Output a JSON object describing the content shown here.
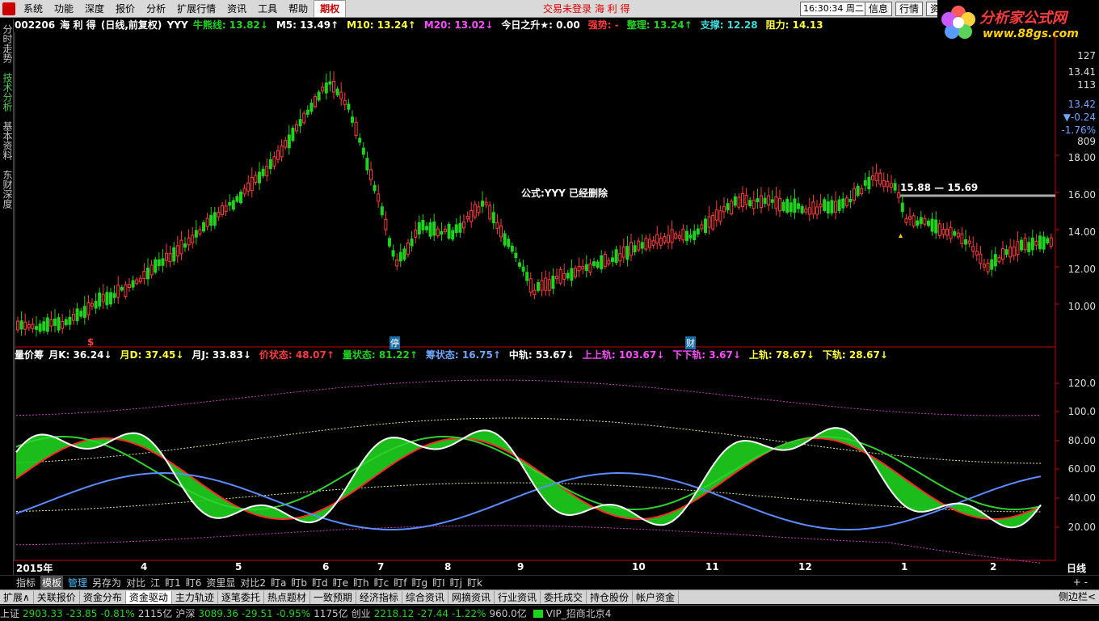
{
  "menu": {
    "items": [
      "系统",
      "功能",
      "深度",
      "报价",
      "分析",
      "扩展行情",
      "资讯",
      "工具",
      "帮助"
    ],
    "active_item": "期权",
    "trade_status": "交易未登录   海 利 得",
    "clock": "16:30:34 周二",
    "buttons": [
      "信息",
      "行情",
      "资"
    ]
  },
  "logo": {
    "brand": "分析家公式网",
    "url": "www.88gs.com"
  },
  "left_tabs": [
    "分时走势",
    "技术分析",
    "基本资料",
    "东财深度"
  ],
  "left_tab_selected": 1,
  "price_header": {
    "code": "002206",
    "name": "海 利 得",
    "period": "(日线,前复权)",
    "formula": "YYY",
    "items": [
      {
        "label": "牛熊线",
        "value": "13.82",
        "arrow": "↓",
        "color": "#1ed31e"
      },
      {
        "label": "M5",
        "value": "13.49",
        "arrow": "↑",
        "color": "#ffffff"
      },
      {
        "label": "M10",
        "value": "13.24",
        "arrow": "↑",
        "color": "#ffff3b"
      },
      {
        "label": "M20",
        "value": "13.02",
        "arrow": "↓",
        "color": "#ff4cff"
      },
      {
        "label": "今日之升★",
        "value": "0.00",
        "arrow": "",
        "color": "#ffffff"
      },
      {
        "label": "强势",
        "value": "-",
        "arrow": "",
        "color": "#ff3b3b"
      },
      {
        "label": "整理",
        "value": "13.24",
        "arrow": "↑",
        "color": "#1ed31e"
      },
      {
        "label": "支撑",
        "value": "12.28",
        "arrow": "",
        "color": "#3fdcdc"
      },
      {
        "label": "阻力",
        "value": "14.13",
        "arrow": "",
        "color": "#ffff3b"
      }
    ]
  },
  "price_axis": {
    "labels": [
      "127",
      "13.41",
      "113",
      "13.42",
      "▼-0.24",
      "-1.76%",
      "809",
      "18.00",
      "16.00",
      "14.00",
      "12.00",
      "10.00"
    ],
    "colors": [
      "#dddddd",
      "#dddddd",
      "#dddddd",
      "#6da8ff",
      "#6da8ff",
      "#6da8ff",
      "#dddddd",
      "#dddddd",
      "#dddddd",
      "#dddddd",
      "#dddddd",
      "#dddddd"
    ]
  },
  "annotations": {
    "formula_deleted": "公式:YYY 已经删除",
    "range_label": "15.88 — 15.69",
    "marks": [
      "$",
      "停",
      "财"
    ]
  },
  "indicator_header": {
    "title": "量价筹",
    "items": [
      {
        "label": "月K",
        "value": "36.24",
        "arrow": "↓",
        "color": "#ffffff"
      },
      {
        "label": "月D",
        "value": "37.45",
        "arrow": "↓",
        "color": "#ffff3b"
      },
      {
        "label": "月J",
        "value": "33.83",
        "arrow": "↓",
        "color": "#ffffff"
      },
      {
        "label": "价状态",
        "value": "48.07",
        "arrow": "↑",
        "color": "#ff3b3b"
      },
      {
        "label": "量状态",
        "value": "81.22",
        "arrow": "↑",
        "color": "#1ed31e"
      },
      {
        "label": "筹状态",
        "value": "16.75",
        "arrow": "↑",
        "color": "#6da8ff"
      },
      {
        "label": "中轨",
        "value": "53.67",
        "arrow": "↓",
        "color": "#ffffff"
      },
      {
        "label": "上上轨",
        "value": "103.67",
        "arrow": "↓",
        "color": "#ff4cff"
      },
      {
        "label": "下下轨",
        "value": "3.67",
        "arrow": "↓",
        "color": "#ff4cff"
      },
      {
        "label": "上轨",
        "value": "78.67",
        "arrow": "↓",
        "color": "#ffff3b"
      },
      {
        "label": "下轨",
        "value": "28.67",
        "arrow": "↓",
        "color": "#ffff3b"
      }
    ]
  },
  "indicator_axis": [
    "120.0",
    "100.0",
    "80.00",
    "60.00",
    "40.00",
    "20.00"
  ],
  "x_axis": [
    "2015年",
    "4",
    "5",
    "6",
    "7",
    "8",
    "9",
    "10",
    "11",
    "12",
    "1",
    "2",
    "日线"
  ],
  "indicator_tabs": [
    "指标",
    "模板",
    "管理",
    "另存为",
    "对比",
    "江",
    "盯1",
    "盯6",
    "资里显",
    "对比2",
    "盯a",
    "盯b",
    "盯d",
    "盯e",
    "盯h",
    "盯c",
    "盯f",
    "盯g",
    "盯I",
    "盯j",
    "盯k"
  ],
  "indicator_tab_selected": 1,
  "indicator_tab_highlight": 2,
  "zoom_buttons": "+ -",
  "func_tabs": [
    "扩展∧",
    "关联报价",
    "资金分布",
    "资金驱动",
    "主力轨迹",
    "逐笔委托",
    "热点题材",
    "一致预期",
    "经济指标",
    "综合资讯",
    "网摘资讯",
    "行业资讯",
    "委托成交",
    "持仓股份",
    "帐户资金"
  ],
  "func_tab_selected": 3,
  "sidebar_label": "侧边栏<",
  "status": {
    "sh_label": "上证",
    "sh_value": "2903.33",
    "sh_change": "-23.85",
    "sh_pct": "-0.81%",
    "sh_amount": "2115亿",
    "hs_label": "沪深",
    "hs_value": "3089.36",
    "hs_change": "-29.51",
    "hs_pct": "-0.95%",
    "hs_amount": "1175亿",
    "cy_label": "创业",
    "cy_value": "2218.12",
    "cy_change": "-27.44",
    "cy_pct": "-1.22%",
    "cy_amount": "960.0亿",
    "server": "VIP_招商北京4"
  },
  "colors": {
    "up": "#ff3b3b",
    "down": "#1ed31e",
    "ma_white": "#ffffff",
    "ma_gray": "#9a9a9a"
  }
}
